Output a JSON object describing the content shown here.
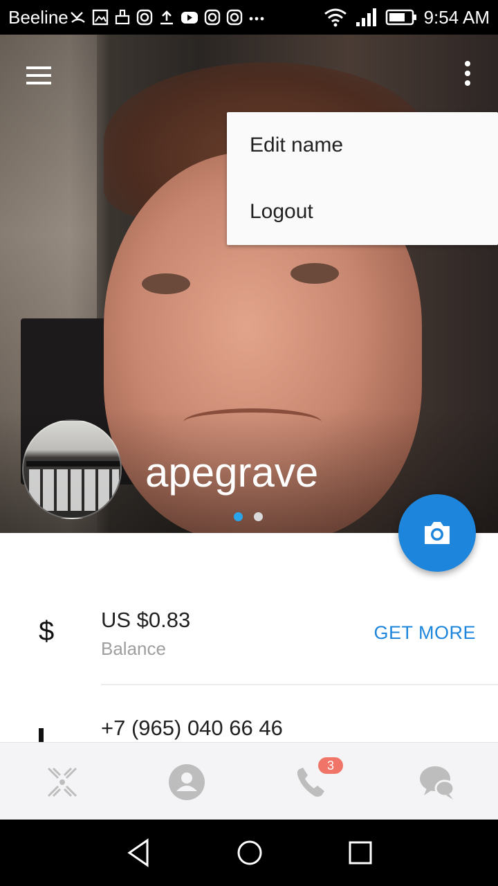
{
  "status_bar": {
    "carrier": "Beeline",
    "time": "9:54 AM",
    "notification_icons": [
      "missed-call-icon",
      "image-icon",
      "cleaner-icon",
      "instagram-icon",
      "upload-icon",
      "youtube-icon",
      "instagram-icon",
      "instagram-icon",
      "more-dots-icon"
    ],
    "system_icons": [
      "wifi-icon",
      "signal-icon",
      "battery-icon"
    ]
  },
  "header": {
    "menu_icon": "hamburger-menu-icon",
    "more_icon": "more-vert-icon",
    "username": "apegrave",
    "pager": {
      "count": 2,
      "active_index": 0
    }
  },
  "popup_menu": {
    "items": [
      "Edit name",
      "Logout"
    ]
  },
  "fab": {
    "icon": "camera-icon"
  },
  "balance": {
    "icon": "$",
    "value": "US $0.83",
    "label": "Balance",
    "action": "GET MORE"
  },
  "phone": {
    "icon": "phone-icon",
    "value": "+7 (965) 040 66 46"
  },
  "bottom_nav": {
    "tabs": [
      {
        "name": "keypad",
        "icon": "dialer-x-icon"
      },
      {
        "name": "profile",
        "icon": "person-icon"
      },
      {
        "name": "calls",
        "icon": "phone-icon",
        "badge": "3"
      },
      {
        "name": "chats",
        "icon": "chat-bubbles-icon"
      }
    ]
  },
  "system_nav": [
    "back-icon",
    "home-icon",
    "recents-icon"
  ],
  "colors": {
    "accent": "#1d86dc",
    "badge": "#f07568",
    "pager_active": "#2aa5ea"
  }
}
